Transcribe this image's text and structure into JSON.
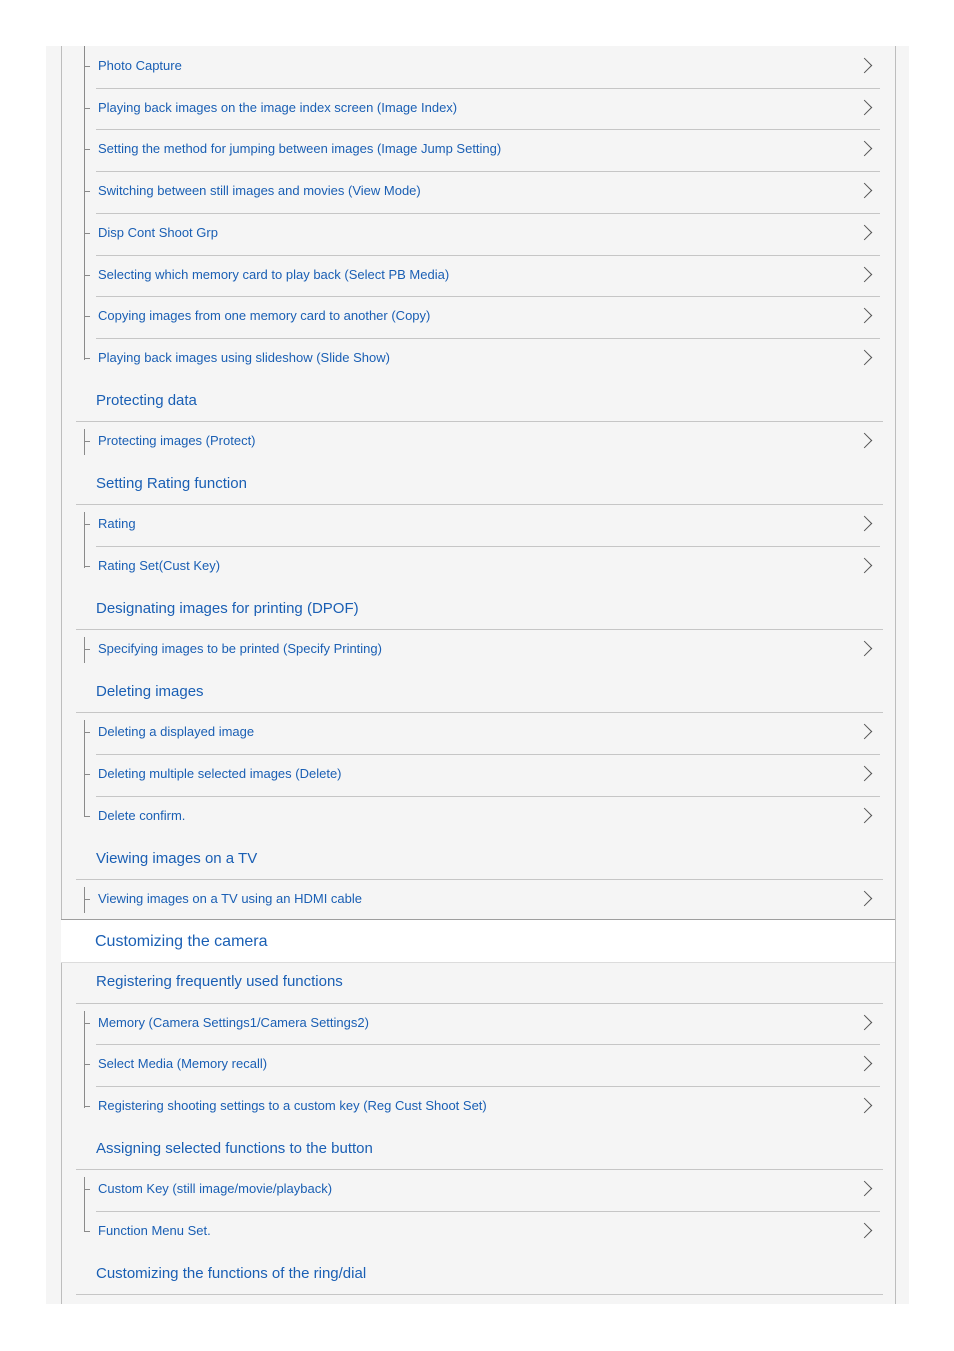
{
  "groups": [
    {
      "items": [
        "Photo Capture",
        "Playing back images on the image index screen (Image Index)",
        "Setting the method for jumping between images (Image Jump Setting)",
        "Switching between still images and movies (View Mode)",
        "Disp Cont Shoot Grp",
        "Selecting which memory card to play back (Select PB Media)",
        "Copying images from one memory card to another (Copy)",
        "Playing back images using slideshow (Slide Show)"
      ]
    },
    {
      "title": "Protecting data",
      "items": [
        "Protecting images (Protect)"
      ]
    },
    {
      "title": "Setting Rating function",
      "items": [
        "Rating",
        "Rating Set(Cust Key)"
      ]
    },
    {
      "title": "Designating images for printing (DPOF)",
      "items": [
        "Specifying images to be printed (Specify Printing)"
      ]
    },
    {
      "title": "Deleting images",
      "items": [
        "Deleting a displayed image",
        "Deleting multiple selected images (Delete)",
        "Delete confirm."
      ]
    },
    {
      "title": "Viewing images on a TV",
      "items": [
        "Viewing images on a TV using an HDMI cable"
      ]
    },
    {
      "title": "Registering frequently used functions",
      "items": [
        "Memory (Camera Settings1/Camera Settings2)",
        "Select Media (Memory recall)",
        "Registering shooting settings to a custom key (Reg Cust Shoot Set)"
      ]
    },
    {
      "title": "Assigning selected functions to the button",
      "items": [
        "Custom Key (still image/movie/playback)",
        "Function Menu Set."
      ]
    },
    {
      "title": "Customizing the functions of the ring/dial",
      "items": []
    }
  ],
  "section": {
    "label": "Customizing the camera"
  },
  "colors": {
    "link": "#1a5fb4",
    "background": "#f5f5f5",
    "divider": "#c6c6c6",
    "chevron": "#555555"
  },
  "icons": {
    "item_arrow": "chevron-right-icon"
  }
}
